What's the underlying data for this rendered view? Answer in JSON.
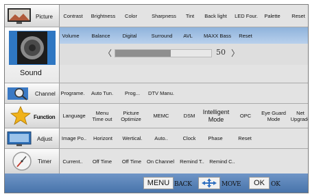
{
  "categories": {
    "picture": "Picture",
    "sound": "Sound",
    "channel": "Channel",
    "function": "Function",
    "adjust": "Adjust",
    "timer": "Timer"
  },
  "picture_items": [
    "Contrast",
    "Brightness",
    "Color",
    "Sharpness",
    "Tint",
    "Back light",
    "LED Four.",
    "Palette",
    "Reset"
  ],
  "sound_items": [
    "Volume",
    "Balance",
    "Digital",
    "Surround",
    "AVL",
    "MAXX Bass",
    "Reset"
  ],
  "sound_slider": {
    "value_text": "50",
    "level_percent": 58,
    "left_arrow": "〈",
    "right_arrow": "〉"
  },
  "channel_items": [
    "Programe.",
    "Auto Tun.",
    "Prog...",
    "DTV Manu."
  ],
  "function_items": [
    "Language",
    "Menu Time out",
    "Picture Optimize",
    "MEMC",
    "DSM",
    "Intelligent Mode",
    "OPC",
    "Eye Guard Mode",
    "Net Upgrade"
  ],
  "adjust_items": [
    "Image Po..",
    "Horizont",
    "Wertical.",
    "Auto..",
    "Clock",
    "Phase",
    "Reset"
  ],
  "timer_items": [
    "Current..",
    "Off Time",
    "Off Time",
    "On Channel",
    "Remind T..",
    "Remind C.."
  ],
  "footer": {
    "menu_btn": "MENU",
    "menu_label": "BACK",
    "move_label": "MOVE",
    "ok_btn": "OK",
    "ok_label": "OK"
  },
  "colors": {
    "highlight_blue": "#8fb3dc",
    "footer_blue": "#5a84ba",
    "panel_gray": "#e3e3e3"
  }
}
